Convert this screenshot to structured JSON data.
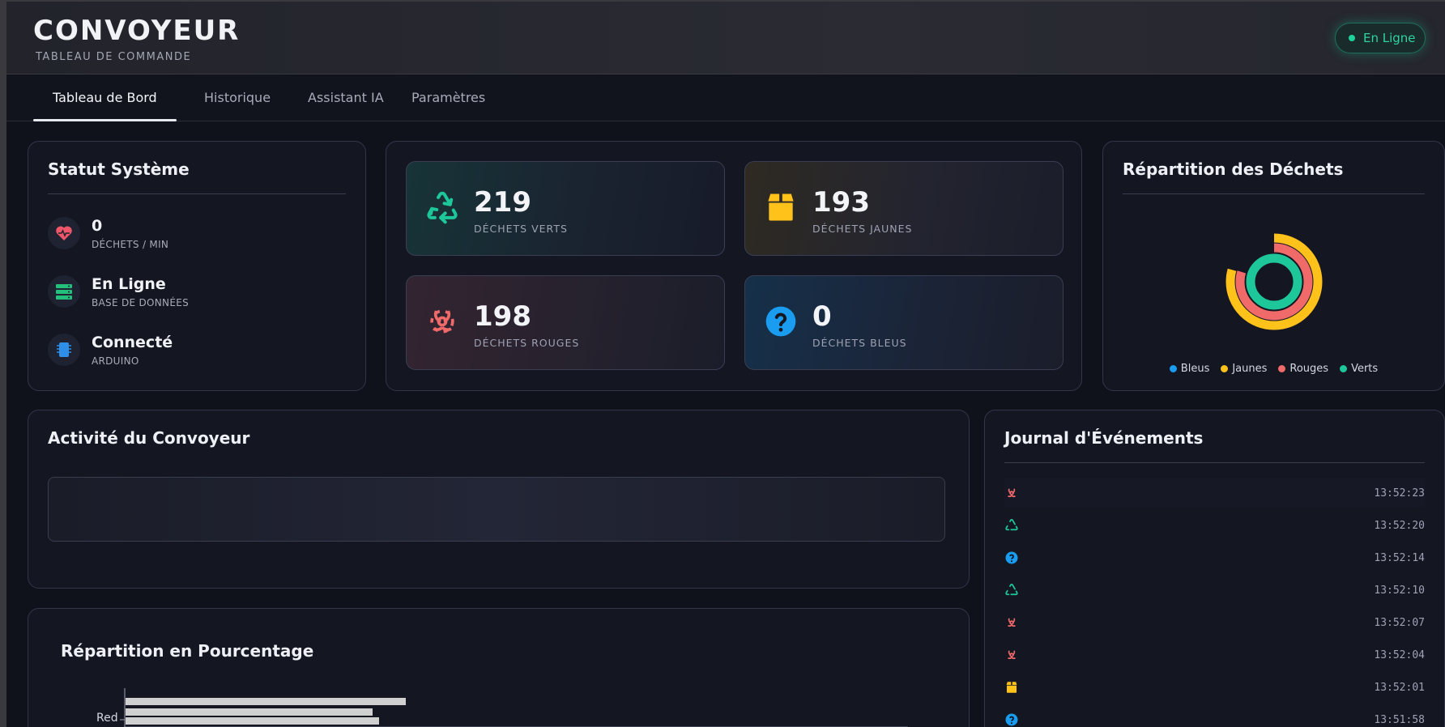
{
  "header": {
    "title": "CONVOYEUR",
    "subtitle": "TABLEAU DE COMMANDE",
    "status": "En Ligne"
  },
  "tabs": [
    {
      "label": "Tableau de Bord",
      "active": true
    },
    {
      "label": "Historique",
      "active": false
    },
    {
      "label": "Assistant IA",
      "active": false
    },
    {
      "label": "Paramètres",
      "active": false
    }
  ],
  "system_status": {
    "title": "Statut Système",
    "items": [
      {
        "value": "0",
        "label": "DÉCHETS / MIN",
        "icon": "heart-pulse-icon"
      },
      {
        "value": "En Ligne",
        "label": "BASE DE DONNÉES",
        "icon": "database-icon"
      },
      {
        "value": "Connecté",
        "label": "ARDUINO",
        "icon": "chip-icon"
      }
    ]
  },
  "stats": [
    {
      "value": "219",
      "label": "DÉCHETS VERTS",
      "icon": "recycle-icon",
      "color": "#1ec79a"
    },
    {
      "value": "193",
      "label": "DÉCHETS JAUNES",
      "icon": "box-icon",
      "color": "#ffc21a"
    },
    {
      "value": "198",
      "label": "DÉCHETS ROUGES",
      "icon": "biohazard-icon",
      "color": "#f06a6a"
    },
    {
      "value": "0",
      "label": "DÉCHETS BLEUS",
      "icon": "question-icon",
      "color": "#1a9df0"
    }
  ],
  "distribution": {
    "title": "Répartition des Déchets",
    "legend": [
      {
        "label": "Bleus",
        "color": "#1a9df0"
      },
      {
        "label": "Jaunes",
        "color": "#ffc21a"
      },
      {
        "label": "Rouges",
        "color": "#f06a6a"
      },
      {
        "label": "Verts",
        "color": "#1ec79a"
      }
    ]
  },
  "chart_data": {
    "type": "pie",
    "categories": [
      "Bleus",
      "Jaunes",
      "Rouges",
      "Verts"
    ],
    "values": [
      0,
      193,
      198,
      219
    ]
  },
  "activity": {
    "title": "Activité du Convoyeur"
  },
  "percent": {
    "title": "Répartition en Pourcentage",
    "visible_label": "Red"
  },
  "events": {
    "title": "Journal d'Événements",
    "rows": [
      {
        "icon": "biohazard-icon",
        "time": "13:52:23",
        "color": "#f06a6a"
      },
      {
        "icon": "recycle-icon",
        "time": "13:52:20",
        "color": "#1ec79a"
      },
      {
        "icon": "question-icon",
        "time": "13:52:14",
        "color": "#1a9df0"
      },
      {
        "icon": "recycle-icon",
        "time": "13:52:10",
        "color": "#1ec79a"
      },
      {
        "icon": "biohazard-icon",
        "time": "13:52:07",
        "color": "#f06a6a"
      },
      {
        "icon": "biohazard-icon",
        "time": "13:52:04",
        "color": "#f06a6a"
      },
      {
        "icon": "box-icon",
        "time": "13:52:01",
        "color": "#ffc21a"
      },
      {
        "icon": "question-icon",
        "time": "13:51:58",
        "color": "#1a9df0"
      }
    ]
  }
}
